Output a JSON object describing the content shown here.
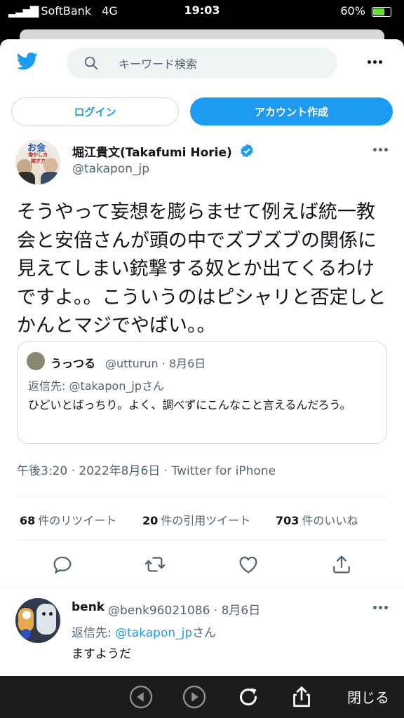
{
  "status_bar": {
    "carrier": "SoftBank",
    "network": "4G",
    "time": "19:03",
    "battery": "60%",
    "battery_level": 0.6
  },
  "search": {
    "placeholder": "キーワード検索"
  },
  "auth": {
    "login_label": "ログイン",
    "signup_label": "アカウント作成"
  },
  "tweet": {
    "author_name": "堀江貴文(Takafumi Horie)",
    "author_handle": "@takapon_jp",
    "avatar_text": [
      "お金",
      "増やし方",
      "稼ぎ方"
    ],
    "text": "そうやって妄想を膨らませて例えば統一教会と安倍さんが頭の中でズブズブの関係に見えてしまい銃撃する奴とか出てくるわけですよ。。こういうのはピシャリと否定しとかんとマジでやばい。。",
    "meta": "午後3:20 · 2022年8月6日 · Twitter for iPhone",
    "quote": {
      "name": "うっつる",
      "meta": "@utturun · 8月6日",
      "reply_to": "返信先: @takapon_jpさん",
      "text": "ひどいとばっちり。よく、調べずにこんなこと言えるんだろう。"
    },
    "stats": {
      "retweets_count": "68",
      "retweets_label": "件のリツイート",
      "quotes_count": "20",
      "quotes_label": "件の引用ツイート",
      "likes_count": "703",
      "likes_label": "件のいいね"
    }
  },
  "reply": {
    "name": "benk",
    "meta": "@benk96021086 · 8月6日",
    "reply_prefix": "返信先: ",
    "reply_mention": "@takapon_jp",
    "reply_suffix": "さん",
    "text": "ますようだ"
  },
  "toolbar": {
    "close_label": "閉じる"
  },
  "colors": {
    "accent": "#1d9bf0",
    "text": "#0f1419",
    "muted": "#536471",
    "border": "#cfd9de"
  }
}
